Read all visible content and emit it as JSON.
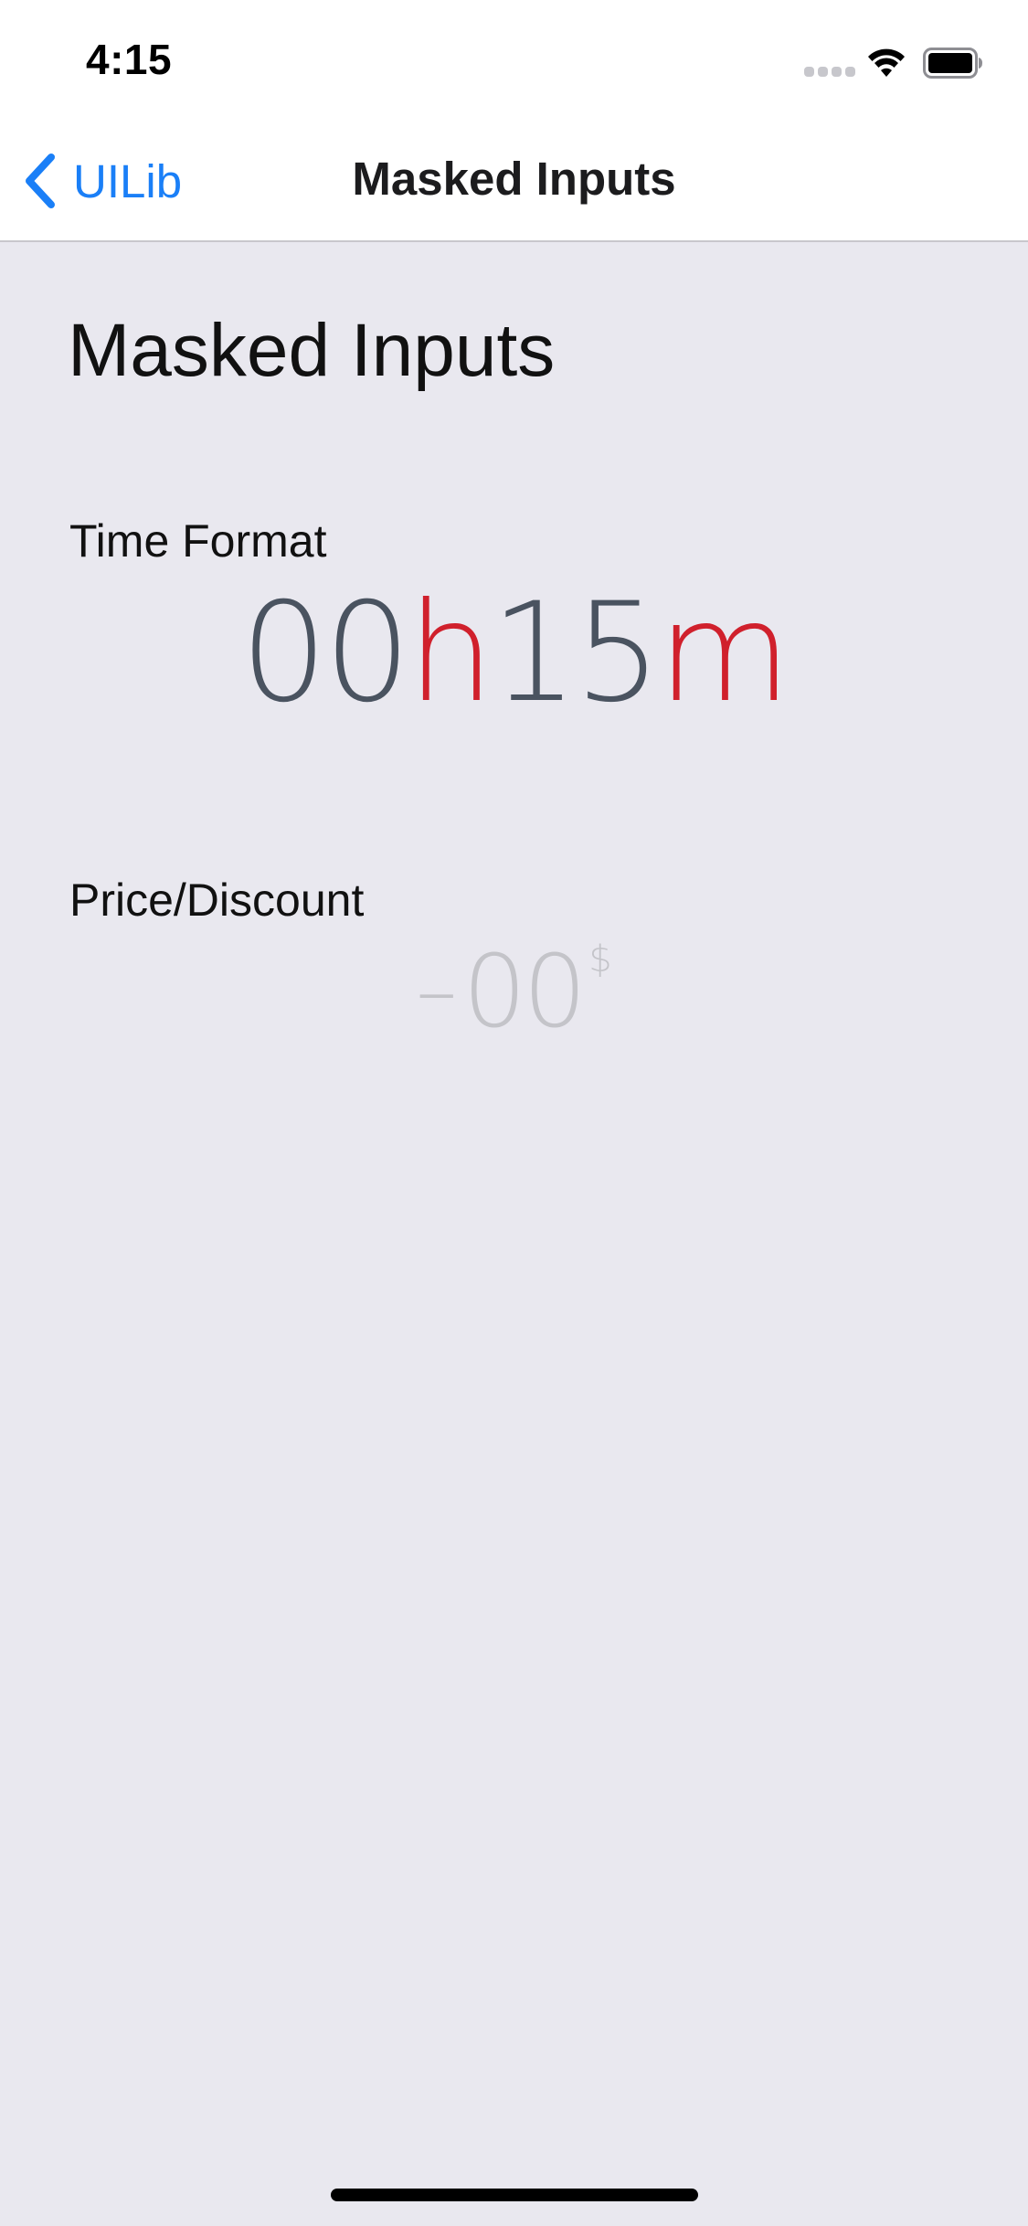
{
  "status_bar": {
    "time": "4:15",
    "signal_icon": "cellular-signal-icon",
    "wifi_icon": "wifi-icon",
    "battery_icon": "battery-icon",
    "battery_level": 1.0
  },
  "nav": {
    "back_icon": "chevron-left-icon",
    "back_label": "UILib",
    "title": "Masked Inputs",
    "accent_color": "#1a7ff7"
  },
  "page": {
    "heading": "Masked Inputs",
    "background_color": "#e9e8ef"
  },
  "time_format": {
    "label": "Time Format",
    "hours": "00",
    "hours_unit": "h",
    "minutes": "15",
    "minutes_unit": "m",
    "digit_color": "#4a5360",
    "unit_color": "#d0202c"
  },
  "price_discount": {
    "label": "Price/Discount",
    "sign": "–",
    "amount": "00",
    "currency": "$",
    "placeholder_color": "#c4c4c9"
  }
}
